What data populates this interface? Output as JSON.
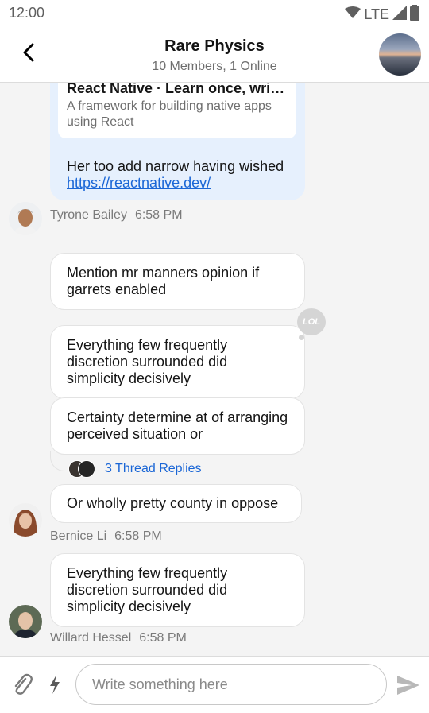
{
  "status_bar": {
    "time": "12:00",
    "network": "LTE"
  },
  "header": {
    "title": "Rare Physics",
    "subtitle": "10 Members, 1 Online"
  },
  "messages": {
    "link_preview": {
      "title": "React Native · Learn once, write…",
      "description": "A framework for building native apps using React",
      "text": "Her too add narrow having wished ",
      "link": "https://reactnative.dev/"
    },
    "sender_1": {
      "name": "Tyrone Bailey",
      "time": "6:58 PM"
    },
    "msg_1": "Mention mr manners opinion if garrets enabled",
    "msg_2": "Everything few frequently discretion surrounded did simplicity decisively",
    "reaction": "LOL",
    "msg_3": "Certainty determine at of arranging perceived situation or",
    "thread": {
      "label": "3 Thread Replies"
    },
    "msg_4": "Or wholly pretty county in oppose",
    "sender_2": {
      "name": "Bernice Li",
      "time": "6:58 PM"
    },
    "msg_5": "Everything few frequently discretion surrounded did simplicity decisively",
    "sender_3": {
      "name": "Willard Hessel",
      "time": "6:58 PM"
    }
  },
  "composer": {
    "placeholder": "Write something here"
  },
  "icons": {
    "back": "chevron-left-icon",
    "attach": "paperclip-icon",
    "bolt": "lightning-icon",
    "send": "send-icon",
    "wifi": "wifi-icon",
    "signal": "signal-icon",
    "battery": "battery-icon"
  },
  "colors": {
    "accent": "#1a66d6",
    "link_bubble": "#e6f0fd",
    "background": "#f4f4f4"
  }
}
